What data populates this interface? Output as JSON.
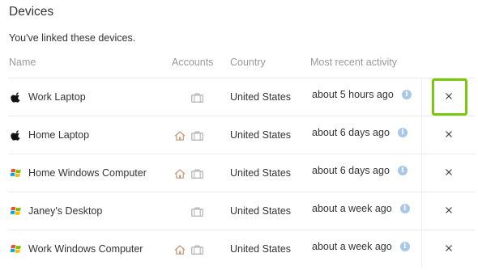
{
  "section": {
    "title": "Devices",
    "description": "You've linked these devices."
  },
  "columns": {
    "name": "Name",
    "accounts": "Accounts",
    "country": "Country",
    "activity": "Most recent activity"
  },
  "devices": [
    {
      "name": "Work Laptop",
      "os_icon": "apple-icon",
      "accounts": [
        "briefcase-icon"
      ],
      "country": "United States",
      "activity": "about 5 hours ago"
    },
    {
      "name": "Home Laptop",
      "os_icon": "apple-icon",
      "accounts": [
        "home-icon",
        "briefcase-icon"
      ],
      "country": "United States",
      "activity": "about 6 days ago"
    },
    {
      "name": "Home Windows Computer",
      "os_icon": "windows-icon",
      "accounts": [
        "home-icon",
        "briefcase-icon"
      ],
      "country": "United States",
      "activity": "about 6 days ago"
    },
    {
      "name": "Janey's Desktop",
      "os_icon": "windows-icon",
      "accounts": [
        "briefcase-icon"
      ],
      "country": "United States",
      "activity": "about a week ago"
    },
    {
      "name": "Work Windows Computer",
      "os_icon": "windows-icon",
      "accounts": [
        "home-icon",
        "briefcase-icon"
      ],
      "country": "United States",
      "activity": "about a week ago"
    }
  ],
  "colors": {
    "highlight": "#7ac70c",
    "info": "#a8c8ea",
    "header_text": "#999999",
    "icon_gray": "#b0b0b0",
    "home_icon": "#c9977a"
  }
}
